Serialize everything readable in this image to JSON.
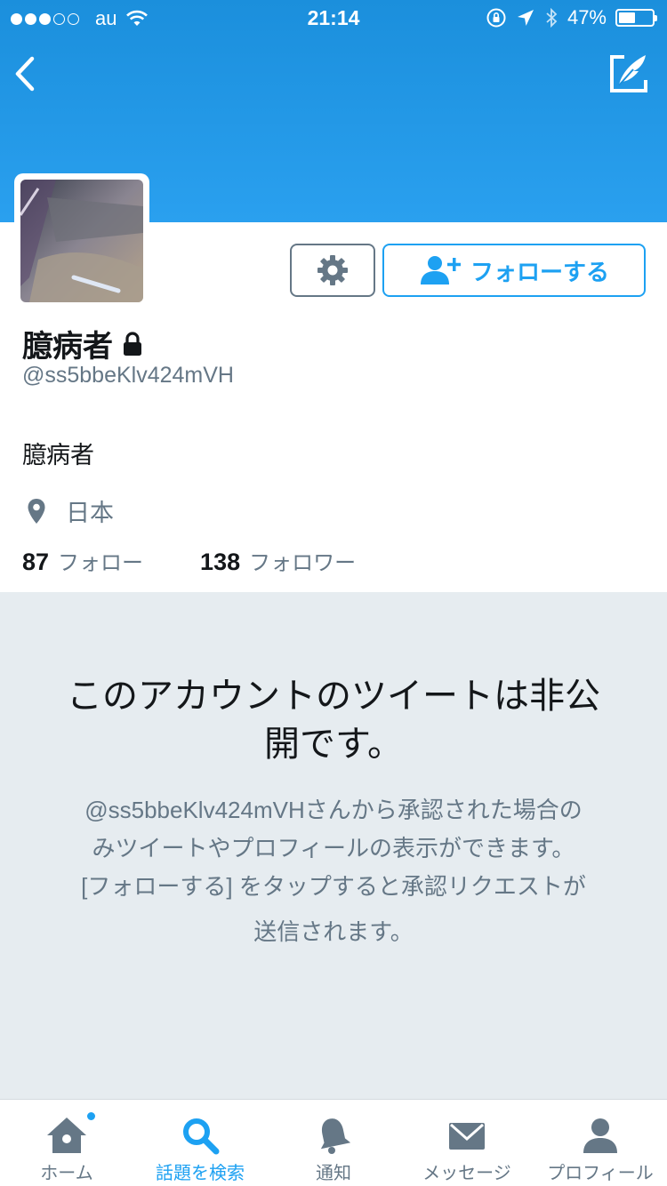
{
  "status_bar": {
    "carrier": "au",
    "time": "21:14",
    "battery": "47%",
    "signal_bars_filled": 3,
    "signal_bars_total": 5
  },
  "profile": {
    "name": "臆病者",
    "handle": "@ss5bbeKlv424mVH",
    "bio": "臆病者",
    "location": "日本",
    "following_count": "87",
    "following_label": "フォロー",
    "followers_count": "138",
    "followers_label": "フォロワー"
  },
  "actions": {
    "follow_label": "フォローする"
  },
  "protected": {
    "title_line1": "このアカウントのツイートは非公",
    "title_line2": "開です。",
    "desc_line1": "@ss5bbeKlv424mVHさんから承認された場合の",
    "desc_line2": "みツイートやプロフィールの表示ができます。",
    "desc_line3": "[フォローする] をタップすると承認リクエストが",
    "desc_line4": "送信されます。"
  },
  "tabs": [
    {
      "label": "ホーム",
      "icon": "home-icon"
    },
    {
      "label": "話題を検索",
      "icon": "search-icon",
      "active": true
    },
    {
      "label": "通知",
      "icon": "bell-icon"
    },
    {
      "label": "メッセージ",
      "icon": "envelope-icon"
    },
    {
      "label": "プロフィール",
      "icon": "person-icon"
    }
  ],
  "colors": {
    "accent": "#1da1f2",
    "banner": "#1b8fdc",
    "muted": "#657786",
    "protected_bg": "#e6ecf0"
  }
}
